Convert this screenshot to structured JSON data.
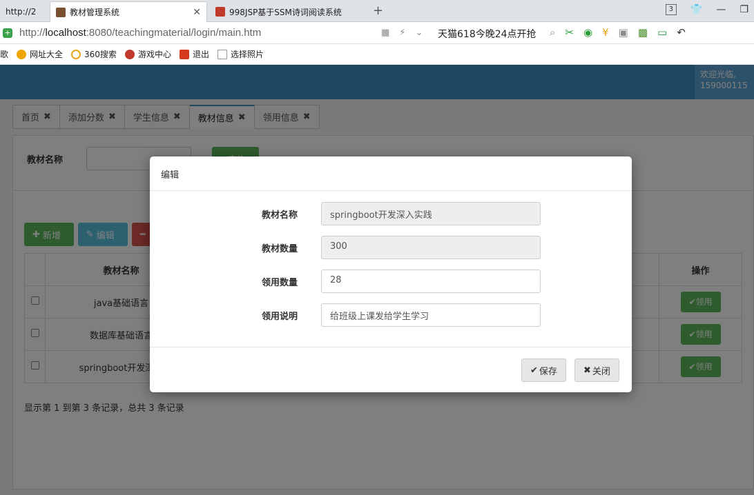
{
  "browser": {
    "tabs": [
      {
        "label": "http://2"
      },
      {
        "label": "教材管理系统"
      },
      {
        "label": "998JSP基于SSM诗词阅读系统"
      }
    ],
    "new_tab": "+",
    "tab_count": "3",
    "url_prefix": "http://",
    "url_host": "localhost",
    "url_rest": ":8080/teachingmaterial/login/main.htm",
    "promo": "天猫618今晚24点开抢",
    "bookmarks": [
      {
        "label": "歌"
      },
      {
        "label": "网址大全"
      },
      {
        "label": "360搜索"
      },
      {
        "label": "游戏中心"
      },
      {
        "label": "退出"
      },
      {
        "label": "选择照片"
      }
    ]
  },
  "header": {
    "welcome_line1": "欢迎光临,",
    "welcome_line2": "159000115"
  },
  "app_tabs": [
    {
      "label": "首页"
    },
    {
      "label": "添加分数"
    },
    {
      "label": "学生信息"
    },
    {
      "label": "教材信息"
    },
    {
      "label": "领用信息"
    }
  ],
  "search": {
    "label": "教材名称",
    "button": "查询"
  },
  "toolbar": {
    "add": "新增",
    "edit": "编辑",
    "delete": ""
  },
  "table": {
    "headers": {
      "name": "教材名称",
      "ops": "操作"
    },
    "rows": [
      {
        "name": "java基础语言",
        "op": "领用"
      },
      {
        "name": "数据库基础语言",
        "op": "领用"
      },
      {
        "name": "springboot开发深入",
        "op": "领用"
      }
    ]
  },
  "records_text": "显示第 1 到第 3 条记录，总共 3 条记录",
  "modal": {
    "title": "编辑",
    "fields": [
      {
        "label": "教材名称",
        "value": "springboot开发深入实践"
      },
      {
        "label": "教材数量",
        "value": "300"
      },
      {
        "label": "领用数量",
        "value": "28"
      },
      {
        "label": "领用说明",
        "value": "给班级上课发给学生学习"
      }
    ],
    "save": "保存",
    "close": "关闭"
  }
}
